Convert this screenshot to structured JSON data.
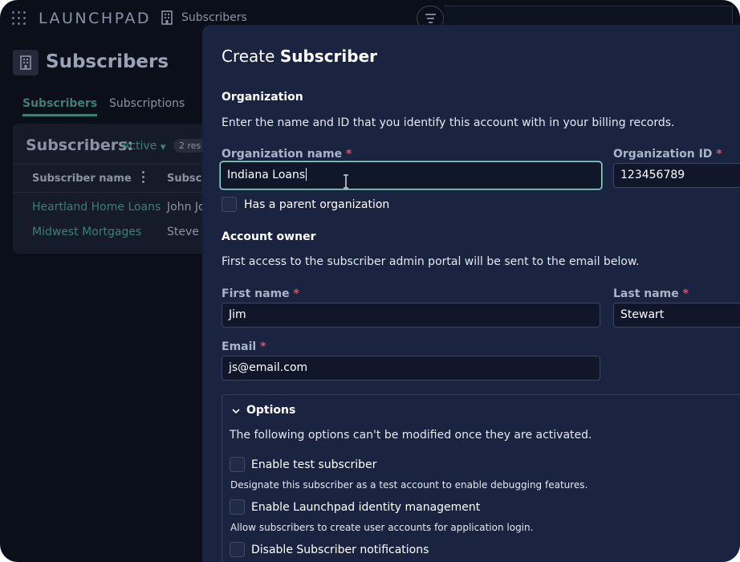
{
  "app": {
    "brand": "LAUNCHPAD",
    "breadcrumb": "Subscribers"
  },
  "page": {
    "title": "Subscribers",
    "tabs": [
      {
        "label": "Subscribers"
      },
      {
        "label": "Subscriptions"
      }
    ],
    "list": {
      "heading": "Subscribers:",
      "filter": "Active",
      "count": "2 res",
      "columns": [
        "Subscriber name",
        "Subscr"
      ],
      "rows": [
        {
          "name": "Heartland Home Loans",
          "contact": "John Jo"
        },
        {
          "name": "Midwest Mortgages",
          "contact": "Steve E"
        }
      ]
    }
  },
  "modal": {
    "title_prefix": "Create",
    "title_bold": "Subscriber",
    "organization": {
      "heading": "Organization",
      "description": "Enter the name and ID that you identify this account with in your billing records.",
      "name_label": "Organization name",
      "name_value": "Indiana Loans",
      "id_label": "Organization ID",
      "id_value": "123456789",
      "parent_label": "Has a parent organization"
    },
    "owner": {
      "heading": "Account owner",
      "description": "First access to the subscriber admin portal will be sent to the email below.",
      "first_label": "First name",
      "first_value": "Jim",
      "last_label": "Last name",
      "last_value": "Stewart",
      "email_label": "Email",
      "email_value": "js@email.com"
    },
    "options": {
      "title": "Options",
      "description": "The following options can't be modified once they are activated.",
      "items": [
        {
          "label": "Enable test subscriber",
          "help": "Designate this subscriber as a test account to enable debugging features."
        },
        {
          "label": "Enable Launchpad identity management",
          "help": "Allow subscribers to create user accounts for application login."
        },
        {
          "label": "Disable Subscriber notifications",
          "help": ""
        }
      ]
    },
    "required_mark": "*"
  },
  "colors": {
    "accent": "#3f7f72",
    "modal_bg": "#1a2440",
    "required": "#e0506a",
    "focus": "#9fd8d2"
  }
}
